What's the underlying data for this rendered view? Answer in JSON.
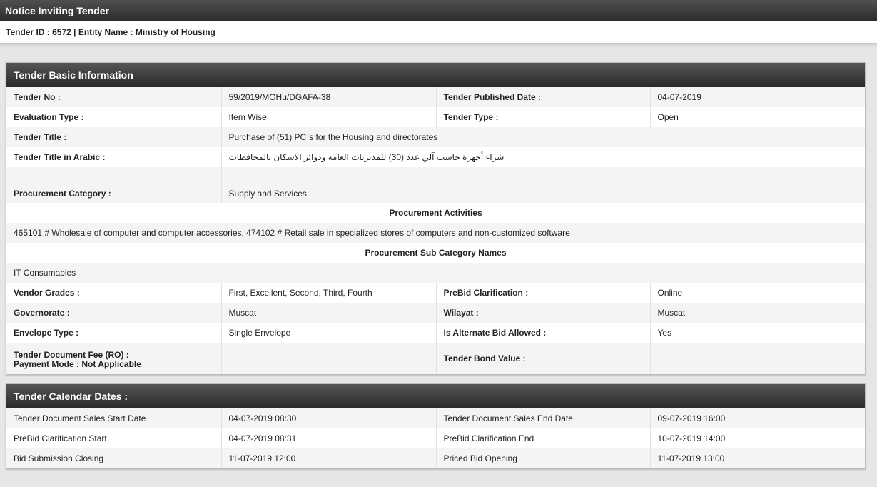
{
  "header": {
    "title": "Notice Inviting Tender",
    "subtitle": "Tender ID : 6572 | Entity Name : Ministry of Housing"
  },
  "basic": {
    "title": "Tender Basic Information",
    "tender_no_label": "Tender No :",
    "tender_no": "59/2019/MOHu/DGAFA-38",
    "published_label": "Tender Published Date :",
    "published": "04-07-2019",
    "eval_label": "Evaluation Type :",
    "eval": "Item Wise",
    "type_label": "Tender Type :",
    "type": "Open",
    "title_label": "Tender Title :",
    "tender_title": "Purchase of (51) PC`s for the Housing and directorates",
    "arabic_label": "Tender Title in Arabic :",
    "arabic": "شراء أجهزة حاسب آلي عدد (30) للمديريات العامه ودوائر الاسكان بالمحافظات",
    "category_label": "Procurement Category :",
    "category": "Supply and Services",
    "activities_label": "Procurement Activities",
    "activities": "465101 # Wholesale of computer and computer accessories, 474102 # Retail sale in specialized stores of computers and non-customized software",
    "subcat_label": "Procurement Sub Category Names",
    "subcat": "IT Consumables",
    "grades_label": "Vendor Grades :",
    "grades": "First, Excellent, Second, Third, Fourth",
    "prebid_label": "PreBid Clarification :",
    "prebid": "Online",
    "gov_label": "Governorate :",
    "gov": "Muscat",
    "wilayat_label": "Wilayat :",
    "wilayat": "Muscat",
    "envelope_label": "Envelope Type :",
    "envelope": "Single Envelope",
    "alt_label": "Is Alternate Bid Allowed :",
    "alt": "Yes",
    "fee_label": "Tender Document Fee (RO) :",
    "payment_label": "Payment Mode :  Not Applicable",
    "bond_label": "Tender Bond Value :"
  },
  "calendar": {
    "title": "Tender Calendar Dates :",
    "rows": [
      {
        "l1": "Tender Document Sales Start Date",
        "v1": "04-07-2019 08:30",
        "l2": "Tender Document Sales End Date",
        "v2": "09-07-2019 16:00"
      },
      {
        "l1": "PreBid Clarification Start",
        "v1": "04-07-2019 08:31",
        "l2": "PreBid Clarification End",
        "v2": "10-07-2019 14:00"
      },
      {
        "l1": "Bid Submission Closing",
        "v1": "11-07-2019 12:00",
        "l2": "Priced Bid Opening",
        "v2": "11-07-2019 13:00"
      }
    ]
  }
}
